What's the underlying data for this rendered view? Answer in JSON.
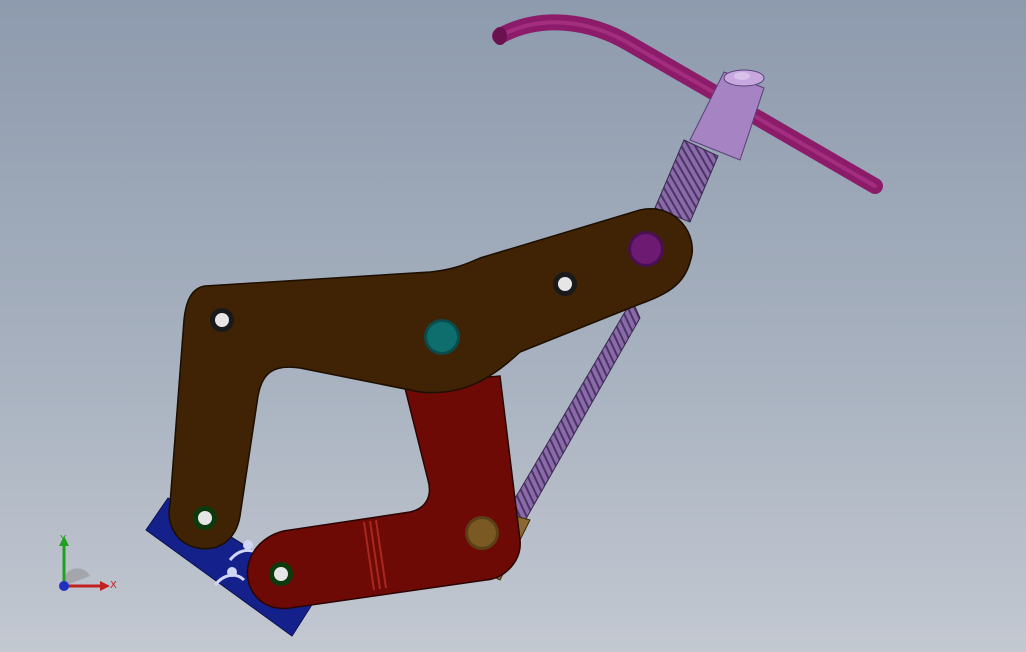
{
  "app": {
    "window_title": ""
  },
  "triad": {
    "x_label": "X",
    "y_label": "Y"
  },
  "colors": {
    "background_top": "#8e9bae",
    "background_bottom": "#c3c8d1",
    "frame_arm": "#3f2304",
    "jaw_lever": "#6e0a06",
    "clamp_pad": "#15218a",
    "screw": "#8a6aa8",
    "screw_collar": "#a684c4",
    "handle": "#8c1c6a",
    "pin_teal": "#0e6e6e",
    "pin_purple": "#6c1a72",
    "pin_tan": "#7a5a22",
    "axis_x": "#c02020",
    "axis_y": "#20a020",
    "axis_z": "#2030c0"
  },
  "parts": [
    {
      "name": "frame-arm"
    },
    {
      "name": "jaw-lever"
    },
    {
      "name": "clamp-pad"
    },
    {
      "name": "lead-screw"
    },
    {
      "name": "t-handle"
    }
  ]
}
